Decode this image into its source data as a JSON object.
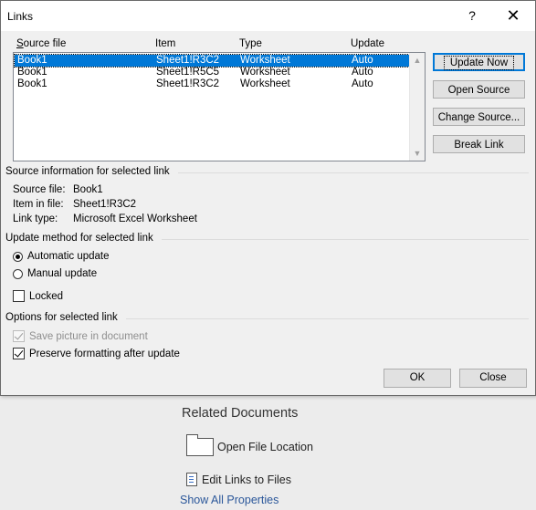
{
  "background": {
    "related_title": "Related Documents",
    "open_file_location": "Open File Location",
    "edit_links": "Edit Links to Files",
    "show_all": "Show All Properties"
  },
  "dialog": {
    "title": "Links",
    "help": "?",
    "close": "✕",
    "columns": {
      "source": "Source file",
      "item": "Item",
      "type": "Type",
      "update": "Update"
    },
    "links": [
      {
        "source": "Book1",
        "item": "Sheet1!R3C2",
        "type": "Worksheet",
        "update": "Auto",
        "selected": true
      },
      {
        "source": "Book1",
        "item": "Sheet1!R5C5",
        "type": "Worksheet",
        "update": "Auto",
        "selected": false
      },
      {
        "source": "Book1",
        "item": "Sheet1!R3C2",
        "type": "Worksheet",
        "update": "Auto",
        "selected": false
      }
    ],
    "buttons": {
      "update_now": "Update Now",
      "open_source": "Open Source",
      "change_source": "Change Source...",
      "break_link": "Break Link",
      "ok": "OK",
      "close": "Close"
    },
    "source_info": {
      "title": "Source information for selected link",
      "source_file_label": "Source file:",
      "source_file_value": "Book1",
      "item_label": "Item in file:",
      "item_value": "Sheet1!R3C2",
      "link_type_label": "Link type:",
      "link_type_value": "Microsoft Excel Worksheet"
    },
    "update_method": {
      "title": "Update method for selected link",
      "automatic": "Automatic update",
      "manual": "Manual update",
      "locked": "Locked",
      "selected": "automatic",
      "locked_checked": false
    },
    "options": {
      "title": "Options for selected link",
      "save_picture": "Save picture in document",
      "save_picture_checked": true,
      "save_picture_enabled": false,
      "preserve": "Preserve formatting after update",
      "preserve_checked": true
    }
  },
  "colors": {
    "selection": "#0078d7",
    "link_blue": "#2b579a"
  }
}
